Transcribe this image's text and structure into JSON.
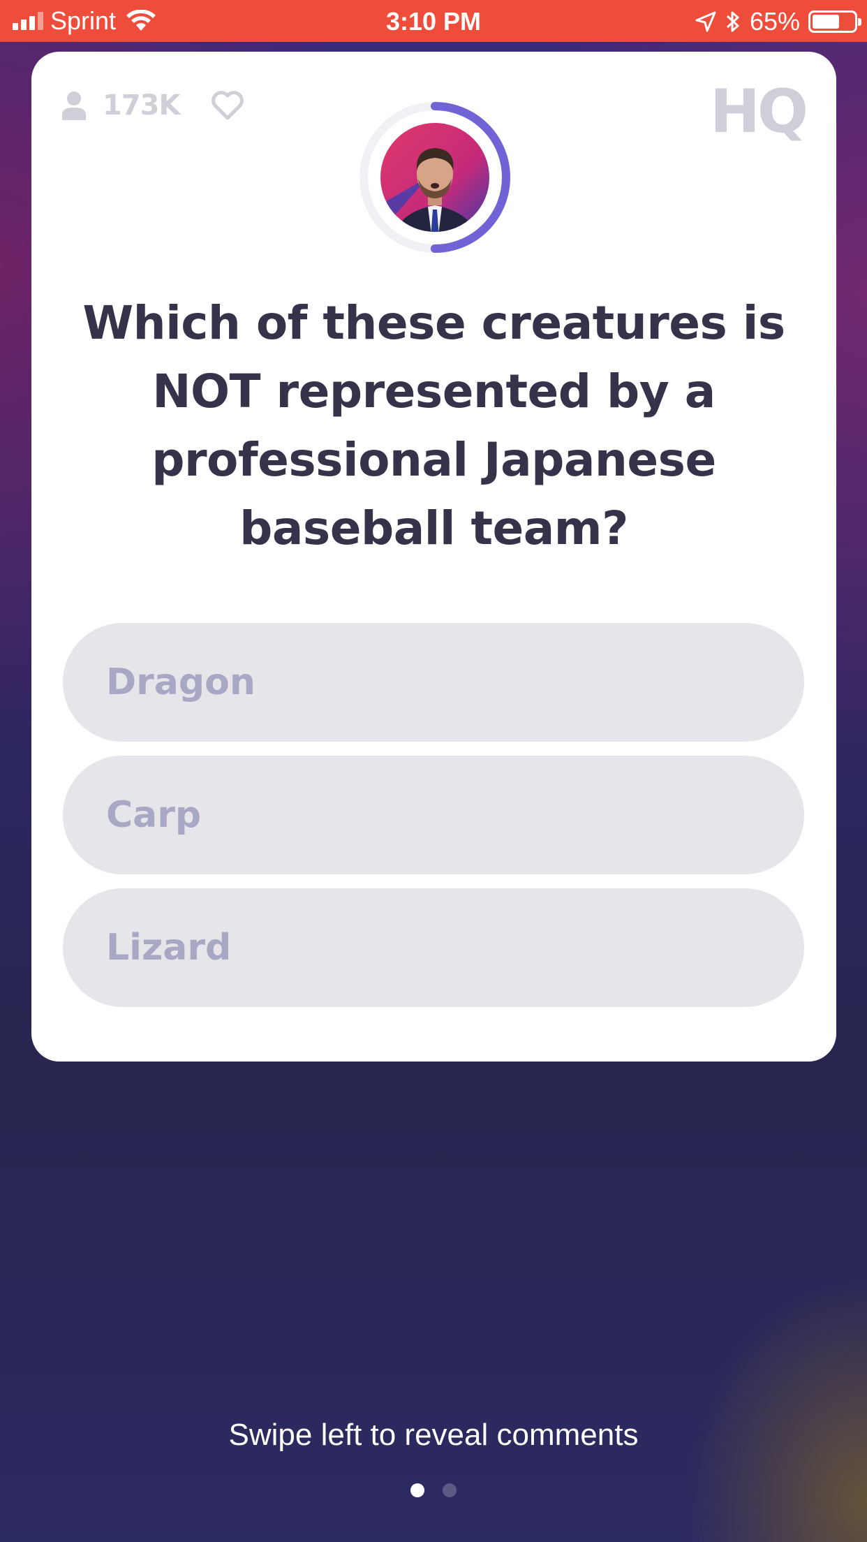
{
  "status_bar": {
    "carrier": "Sprint",
    "time": "3:10 PM",
    "battery": "65%",
    "battery_level": 0.65,
    "icons": [
      "signal-icon",
      "wifi-icon",
      "location-icon",
      "bluetooth-icon",
      "battery-icon"
    ]
  },
  "card": {
    "viewer_count": "173K",
    "logo": "HQ",
    "question": "Which of these creatures is NOT represented by a professional Japanese baseball team?",
    "answers": [
      {
        "label": "Dragon"
      },
      {
        "label": "Carp"
      },
      {
        "label": "Lizard"
      }
    ],
    "timer_progress": 0.5,
    "icons": [
      "person-icon",
      "heart-icon"
    ]
  },
  "footer": {
    "hint": "Swipe left to reveal comments",
    "page_count": 2,
    "active_page": 1
  },
  "colors": {
    "status_bar": "#ef4d3c",
    "accent": "#6f63d6",
    "question_text": "#34334a",
    "answer_bg": "#e6e5ea",
    "answer_text": "#a9a8c4"
  }
}
